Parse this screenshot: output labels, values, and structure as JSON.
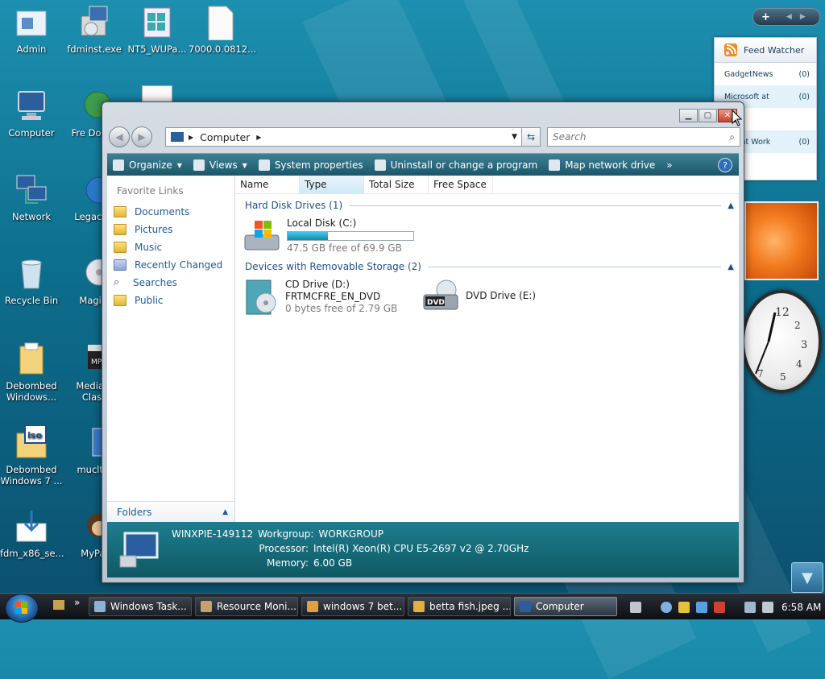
{
  "desktop": {
    "icons_left": [
      {
        "label": "Admin"
      },
      {
        "label": "Computer"
      },
      {
        "label": "Network"
      },
      {
        "label": "Recycle Bin"
      },
      {
        "label": "Debombed Windows..."
      },
      {
        "label": "Debombed Windows 7 ..."
      },
      {
        "label": "fdm_x86_se..."
      }
    ],
    "icons_second": [
      {
        "label": "fdminst.exe"
      },
      {
        "label": "Fre Downl"
      },
      {
        "label": "LegacyU"
      },
      {
        "label": "MagicI"
      },
      {
        "label": "Media P Class"
      },
      {
        "label": "mucltui"
      },
      {
        "label": "MyPal"
      }
    ],
    "icons_top": [
      {
        "label": "NT5_WUPa..."
      },
      {
        "label": "7000.0.0812..."
      }
    ]
  },
  "gadgets": {
    "feed_watcher": {
      "title": "Feed Watcher",
      "rows": [
        {
          "name": "GadgetNews",
          "count": "(0)"
        },
        {
          "name": "Microsoft at",
          "count": "(0)"
        },
        {
          "name": "",
          "count": ""
        },
        {
          "name": "soft at Work",
          "count": "(0)"
        }
      ]
    },
    "control_plus": "+"
  },
  "window": {
    "address": {
      "path": "Computer",
      "search_placeholder": "Search"
    },
    "toolbar": {
      "organize": "Organize",
      "views": "Views",
      "system_properties": "System properties",
      "uninstall": "Uninstall or change a program",
      "map_drive": "Map network drive",
      "more": "»"
    },
    "nav": {
      "favorite_links_title": "Favorite Links",
      "links": [
        "Documents",
        "Pictures",
        "Music",
        "Recently Changed",
        "Searches",
        "Public"
      ],
      "folders_label": "Folders"
    },
    "columns": [
      "Name",
      "Type",
      "Total Size",
      "Free Space"
    ],
    "groups": {
      "hard_disks": "Hard Disk Drives (1)",
      "removable": "Devices with Removable Storage (2)"
    },
    "drives": {
      "c": {
        "name": "Local Disk (C:)",
        "free_text": "47.5 GB free of 69.9 GB",
        "used_fraction": 0.32
      },
      "d": {
        "name": "CD Drive (D:)",
        "label": "FRTMCFRE_EN_DVD",
        "free_text": "0 bytes free of 2.79 GB"
      },
      "e": {
        "name": "DVD Drive (E:)",
        "badge": "DVD"
      }
    },
    "details": {
      "computer_name": "WINXPIE-149112",
      "workgroup_label": "Workgroup:",
      "workgroup": "WORKGROUP",
      "processor_label": "Processor:",
      "processor": "Intel(R) Xeon(R) CPU E5-2697 v2 @ 2.70GHz",
      "memory_label": "Memory:",
      "memory": "6.00 GB"
    }
  },
  "taskbar": {
    "buttons": [
      {
        "label": "Windows Task..."
      },
      {
        "label": "Resource Moni..."
      },
      {
        "label": "windows 7 bet..."
      },
      {
        "label": "betta fish.jpeg ..."
      },
      {
        "label": "Computer"
      }
    ],
    "quicklaunch_more": "»",
    "clock": "6:58 AM"
  },
  "colors": {
    "accent": "#1a5568",
    "link": "#1e5b98",
    "details_bg": "#0f5964"
  }
}
